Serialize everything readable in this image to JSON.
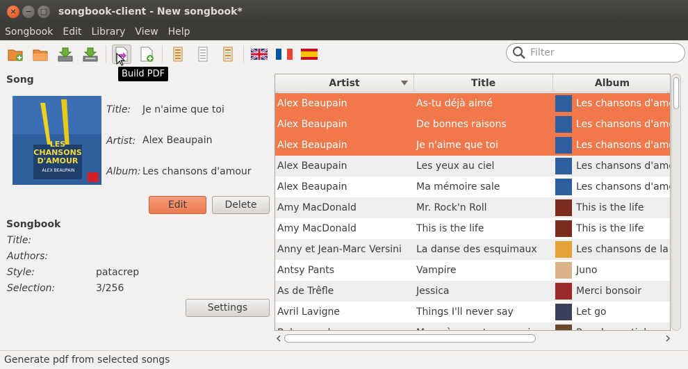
{
  "window": {
    "title": "songbook-client - New songbook*"
  },
  "menu": [
    "Songbook",
    "Edit",
    "Library",
    "View",
    "Help"
  ],
  "toolbar": {
    "search_placeholder": "Filter",
    "tooltip": "Build PDF"
  },
  "song": {
    "heading": "Song",
    "title_label": "Title:",
    "title": "Je n'aime que toi",
    "artist_label": "Artist:",
    "artist": "Alex Beaupain",
    "album_label": "Album:",
    "album": "Les chansons d'amour",
    "edit_label": "Edit",
    "delete_label": "Delete",
    "cover_text": "LES CHANSONS D'AMOUR",
    "cover_sub": "ALEX BEAUPAIN"
  },
  "songbook": {
    "heading": "Songbook",
    "title_label": "Title:",
    "title": "",
    "authors_label": "Authors:",
    "authors": "",
    "style_label": "Style:",
    "style": "patacrep",
    "selection_label": "Selection:",
    "selection": "3/256",
    "settings_label": "Settings"
  },
  "table": {
    "columns": [
      "Artist",
      "Title",
      "Album"
    ],
    "rows": [
      {
        "artist": "Alex Beaupain",
        "title": "As-tu déjà aimé",
        "album": "Les chansons d'amour",
        "selected": true,
        "thumb": "#2d5fa0"
      },
      {
        "artist": "Alex Beaupain",
        "title": "De bonnes raisons",
        "album": "Les chansons d'amour",
        "selected": true,
        "thumb": "#2d5fa0"
      },
      {
        "artist": "Alex Beaupain",
        "title": "Je n'aime que toi",
        "album": "Les chansons d'amour",
        "selected": true,
        "thumb": "#2d5fa0"
      },
      {
        "artist": "Alex Beaupain",
        "title": "Les yeux au ciel",
        "album": "Les chansons d'amour",
        "selected": false,
        "thumb": "#2d5fa0"
      },
      {
        "artist": "Alex Beaupain",
        "title": "Ma mémoire sale",
        "album": "Les chansons d'amour",
        "selected": false,
        "thumb": "#2d5fa0"
      },
      {
        "artist": "Amy MacDonald",
        "title": "Mr. Rock'n Roll",
        "album": "This is the life",
        "selected": false,
        "thumb": "#7a2c1e"
      },
      {
        "artist": "Amy MacDonald",
        "title": "This is the life",
        "album": "This is the life",
        "selected": false,
        "thumb": "#7a2c1e"
      },
      {
        "artist": "Anny et Jean-Marc Versini",
        "title": "La danse des esquimaux",
        "album": "Les chansons de la m",
        "selected": false,
        "thumb": "#e2a43a"
      },
      {
        "artist": "Antsy Pants",
        "title": "Vampire",
        "album": "Juno",
        "selected": false,
        "thumb": "#d9b48a"
      },
      {
        "artist": "As de Trêfle",
        "title": "Jessica",
        "album": "Merci bonsoir",
        "selected": false,
        "thumb": "#9c2a2a"
      },
      {
        "artist": "Avril Lavigne",
        "title": "Things I'll never say",
        "album": "Let go",
        "selected": false,
        "thumb": "#3a3f5c"
      },
      {
        "artist": "Balmorandes",
        "title": "Mon père veut me marier",
        "album": "Parade nuptiale au lac",
        "selected": false,
        "thumb": "#6a4a2a"
      }
    ]
  },
  "status": "Generate pdf from selected songs"
}
